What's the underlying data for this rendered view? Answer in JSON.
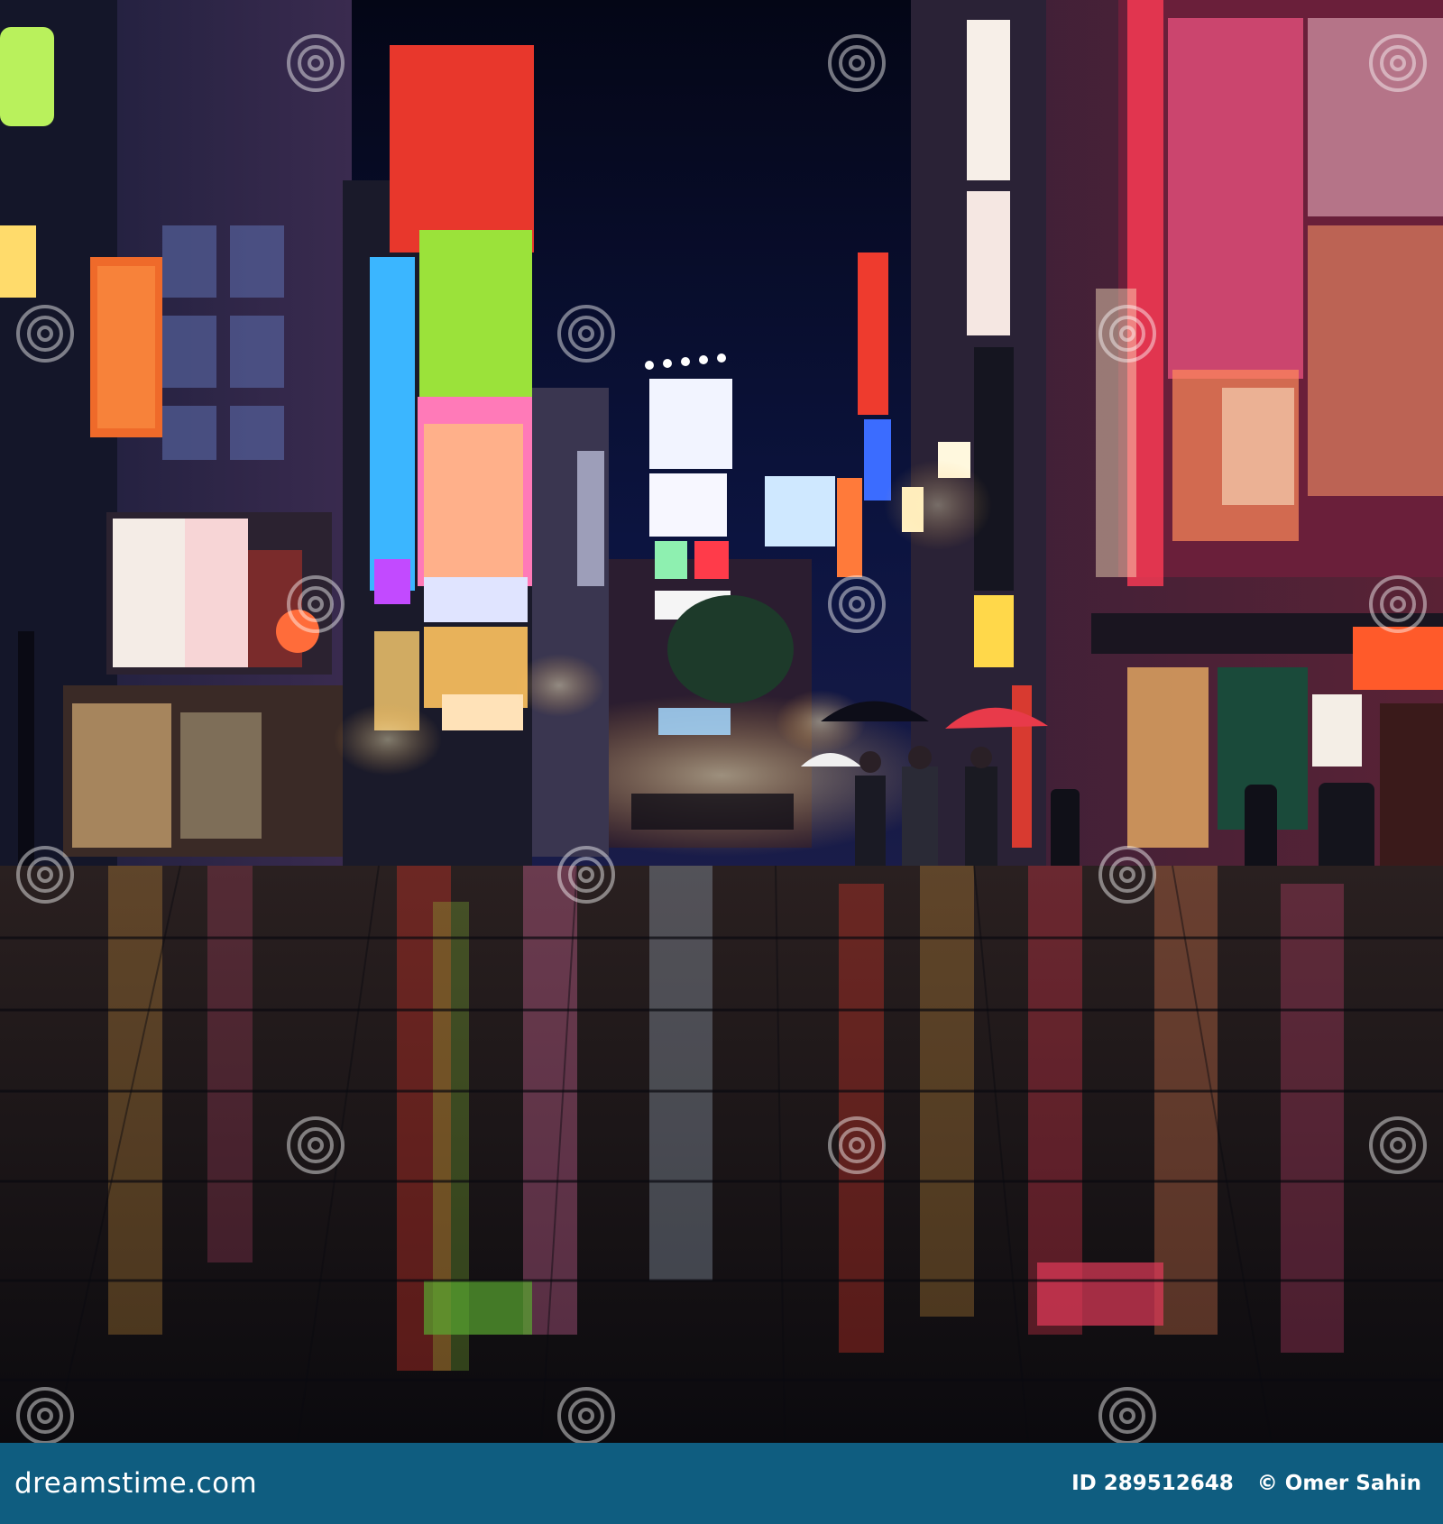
{
  "image": {
    "subject": "Rainy night street lined with neon signs and billboards, pedestrians with umbrellas, reflective wet paving",
    "palette": {
      "sky": "#070a26",
      "pavement": "#141218",
      "neon_red": "#e8372c",
      "neon_green": "#9be23a",
      "neon_pink": "#ff4f8a",
      "warm_glow": "#ffb347",
      "footer": "#0f5d80"
    }
  },
  "watermark": {
    "brand": "dreamstime",
    "icon": "spiral-icon"
  },
  "footer": {
    "site": "dreamstime.com",
    "id_label": "ID 289512648",
    "author": "© Omer Sahin"
  }
}
